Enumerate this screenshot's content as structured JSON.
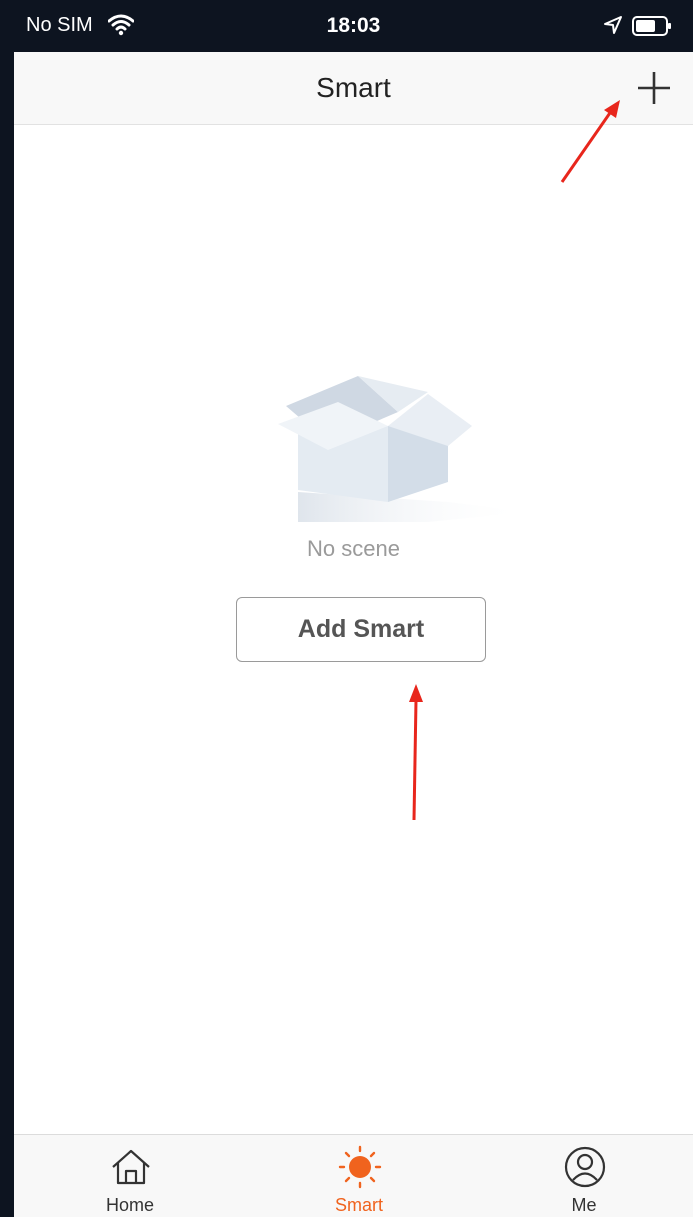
{
  "status_bar": {
    "carrier": "No SIM",
    "time": "18:03"
  },
  "nav": {
    "title": "Smart",
    "add_icon": "plus-icon"
  },
  "empty_state": {
    "icon": "empty-box-icon",
    "message": "No scene",
    "button_label": "Add Smart"
  },
  "tabs": [
    {
      "label": "Home",
      "icon": "home-icon",
      "active": false
    },
    {
      "label": "Smart",
      "icon": "sun-icon",
      "active": true
    },
    {
      "label": "Me",
      "icon": "profile-icon",
      "active": false
    }
  ],
  "colors": {
    "accent": "#f0631e",
    "annotation_arrow": "#e8261c"
  }
}
